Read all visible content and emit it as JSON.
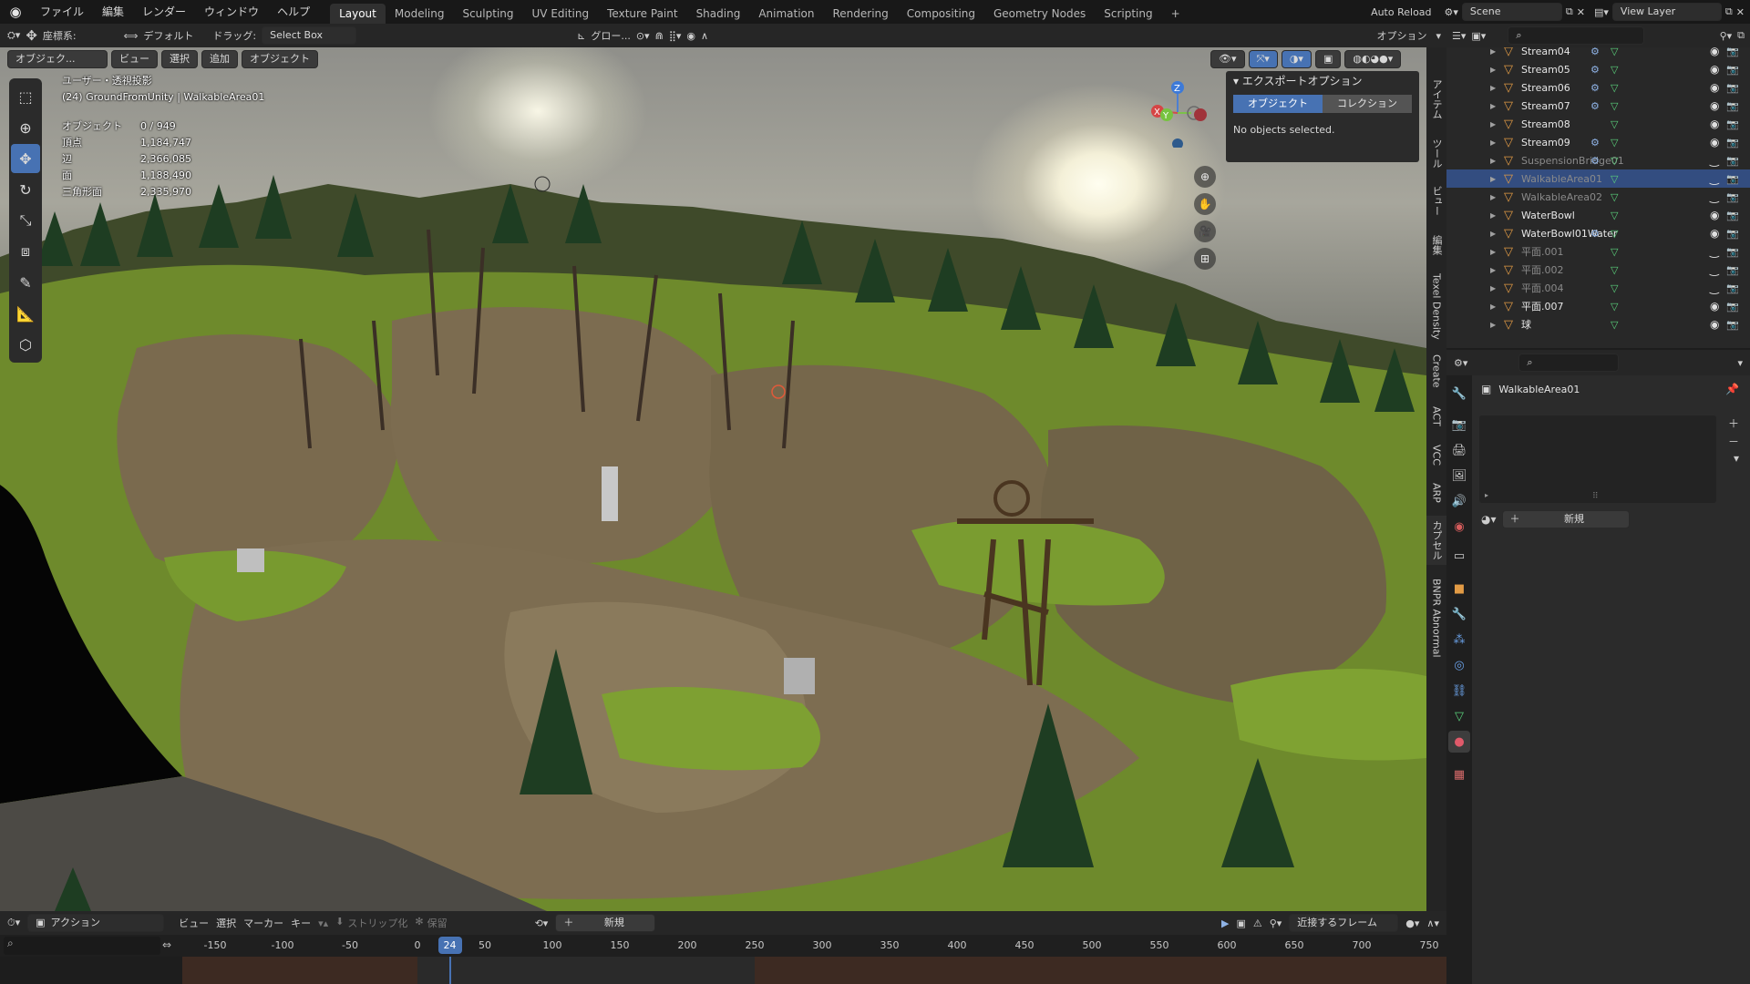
{
  "topbar": {
    "menus": [
      "ファイル",
      "編集",
      "レンダー",
      "ウィンドウ",
      "ヘルプ"
    ],
    "workspaces": [
      {
        "label": "Layout",
        "active": true
      },
      {
        "label": "Modeling",
        "active": false
      },
      {
        "label": "Sculpting",
        "active": false
      },
      {
        "label": "UV Editing",
        "active": false
      },
      {
        "label": "Texture Paint",
        "active": false
      },
      {
        "label": "Shading",
        "active": false
      },
      {
        "label": "Animation",
        "active": false
      },
      {
        "label": "Rendering",
        "active": false
      },
      {
        "label": "Compositing",
        "active": false
      },
      {
        "label": "Geometry Nodes",
        "active": false
      },
      {
        "label": "Scripting",
        "active": false
      }
    ],
    "add_workspace": "+",
    "auto_reload": "Auto Reload",
    "scene": "Scene",
    "view_layer": "View Layer"
  },
  "viewport_header": {
    "orientation_label": "座標系:",
    "orientation_value": "デフォルト",
    "drag_label": "ドラッグ:",
    "drag_value": "Select Box",
    "transform_orientation": "グロー...",
    "options": "オプション"
  },
  "viewport_menus": {
    "mode": "オブジェク...",
    "view": "ビュー",
    "select": "選択",
    "add": "追加",
    "object": "オブジェクト"
  },
  "viewport_info": {
    "view_name": "ユーザー・透視投影",
    "collection": "(24) GroundFromUnity | WalkableArea01",
    "stats": [
      {
        "k": "オブジェクト",
        "v": "0 / 949"
      },
      {
        "k": "頂点",
        "v": "1,184,747"
      },
      {
        "k": "辺",
        "v": "2,366,085"
      },
      {
        "k": "面",
        "v": "1,188,490"
      },
      {
        "k": "三角形面",
        "v": "2,335,970"
      }
    ]
  },
  "gizmo": {
    "x": "X",
    "y": "Y",
    "z": "Z"
  },
  "export_panel": {
    "title": "エクスポートオプション",
    "object_tab": "オブジェクト",
    "collection_tab": "コレクション",
    "message": "No objects selected."
  },
  "npanel_tabs": [
    "アイテム",
    "ツール",
    "ビュー",
    "編集",
    "Texel Density",
    "Create",
    "ACT",
    "VCC",
    "ARP",
    "カプセル",
    "BNPR Abnormal"
  ],
  "outliner": {
    "rows": [
      {
        "name": "Stream04",
        "mod": true,
        "dim": false,
        "selected": false
      },
      {
        "name": "Stream05",
        "mod": true,
        "dim": false,
        "selected": false
      },
      {
        "name": "Stream06",
        "mod": true,
        "dim": false,
        "selected": false
      },
      {
        "name": "Stream07",
        "mod": true,
        "dim": false,
        "selected": false
      },
      {
        "name": "Stream08",
        "mod": false,
        "dim": false,
        "selected": false
      },
      {
        "name": "Stream09",
        "mod": true,
        "dim": false,
        "selected": false
      },
      {
        "name": "SuspensionBridge01",
        "mod": true,
        "dim": true,
        "selected": false
      },
      {
        "name": "WalkableArea01",
        "mod": false,
        "dim": true,
        "selected": true
      },
      {
        "name": "WalkableArea02",
        "mod": false,
        "dim": true,
        "selected": false
      },
      {
        "name": "WaterBowl",
        "mod": false,
        "dim": false,
        "selected": false
      },
      {
        "name": "WaterBowl01Water",
        "mod": true,
        "dim": false,
        "selected": false
      },
      {
        "name": "平面.001",
        "mod": false,
        "dim": true,
        "selected": false
      },
      {
        "name": "平面.002",
        "mod": false,
        "dim": true,
        "selected": false
      },
      {
        "name": "平面.004",
        "mod": false,
        "dim": true,
        "selected": false
      },
      {
        "name": "平面.007",
        "mod": false,
        "dim": false,
        "selected": false
      },
      {
        "name": "球",
        "mod": false,
        "dim": false,
        "selected": false
      }
    ]
  },
  "properties": {
    "object_name": "WalkableArea01",
    "new_button": "新規"
  },
  "timeline": {
    "mode": "アクション",
    "view": "ビュー",
    "select": "選択",
    "marker": "マーカー",
    "key": "キー",
    "push_down": "ストリップ化",
    "stash": "保留",
    "new": "新規",
    "snap": "近接するフレーム",
    "current_frame": "24",
    "ticks": [
      "-150",
      "-100",
      "-50",
      "0",
      "50",
      "100",
      "150",
      "200",
      "250",
      "300",
      "350",
      "400",
      "450",
      "500",
      "550",
      "600",
      "650",
      "700",
      "750"
    ],
    "tick_values": [
      -150,
      -100,
      -50,
      0,
      50,
      100,
      150,
      200,
      250,
      300,
      350,
      400,
      450,
      500,
      550,
      600,
      650,
      700,
      750
    ]
  }
}
